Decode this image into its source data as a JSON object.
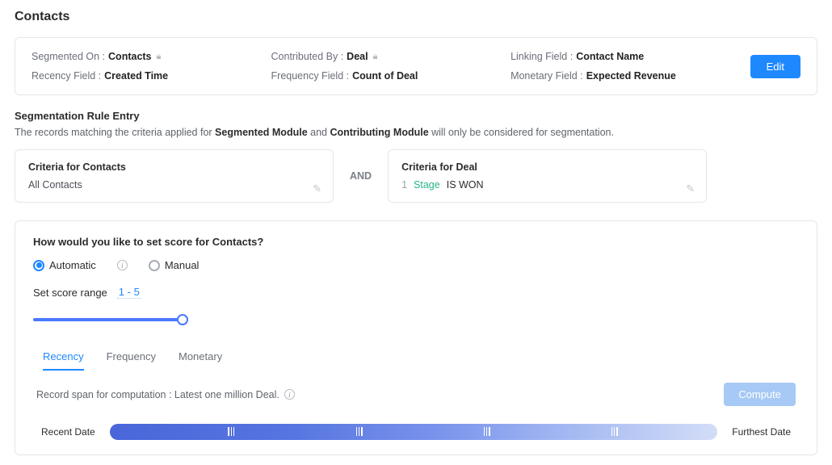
{
  "page_title": "Contacts",
  "summary": {
    "segmented_on_label": "Segmented On :",
    "segmented_on_value": "Contacts",
    "contributed_by_label": "Contributed By :",
    "contributed_by_value": "Deal",
    "linking_field_label": "Linking Field :",
    "linking_field_value": "Contact Name",
    "recency_field_label": "Recency Field :",
    "recency_field_value": "Created Time",
    "frequency_field_label": "Frequency Field :",
    "frequency_field_value": "Count of Deal",
    "monetary_field_label": "Monetary Field :",
    "monetary_field_value": "Expected Revenue",
    "edit_label": "Edit"
  },
  "rule": {
    "heading": "Segmentation Rule Entry",
    "desc_pre": "The records matching the criteria applied for ",
    "desc_b1": "Segmented Module",
    "desc_mid": " and ",
    "desc_b2": "Contributing Module",
    "desc_post": " will only be considered for segmentation."
  },
  "criteria": {
    "contacts_title": "Criteria for Contacts",
    "contacts_body": "All Contacts",
    "and_label": "AND",
    "deal_title": "Criteria for Deal",
    "deal_index": "1",
    "deal_field": "Stage",
    "deal_op": "IS WON"
  },
  "score": {
    "question": "How would you like to set score for Contacts?",
    "option_auto": "Automatic",
    "option_manual": "Manual",
    "range_label": "Set score range",
    "range_value": "1 - 5",
    "tabs": {
      "recency": "Recency",
      "frequency": "Frequency",
      "monetary": "Monetary"
    },
    "compute_text": "Record span for computation : Latest one million Deal.",
    "compute_btn": "Compute",
    "timeline_left": "Recent Date",
    "timeline_right": "Furthest Date"
  }
}
